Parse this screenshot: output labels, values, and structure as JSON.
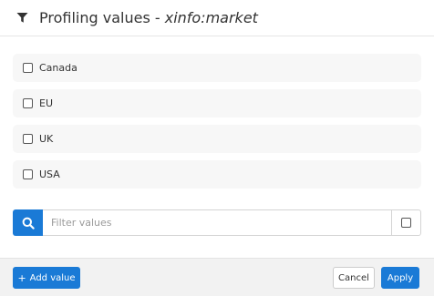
{
  "header": {
    "title_prefix": "Profiling values - ",
    "title_subject": "xinfo:market",
    "icon": "filter-icon"
  },
  "values": [
    {
      "label": "Canada",
      "checked": false
    },
    {
      "label": "EU",
      "checked": false
    },
    {
      "label": "UK",
      "checked": false
    },
    {
      "label": "USA",
      "checked": false
    }
  ],
  "filter": {
    "placeholder": "Filter values",
    "value": "",
    "search_icon": "search-icon"
  },
  "footer": {
    "add_label": "Add value",
    "add_icon": "plus-icon",
    "cancel_label": "Cancel",
    "apply_label": "Apply"
  },
  "colors": {
    "accent": "#1a7ad6",
    "row_background": "#f7f7f7",
    "footer_background": "#f2f2f2"
  }
}
